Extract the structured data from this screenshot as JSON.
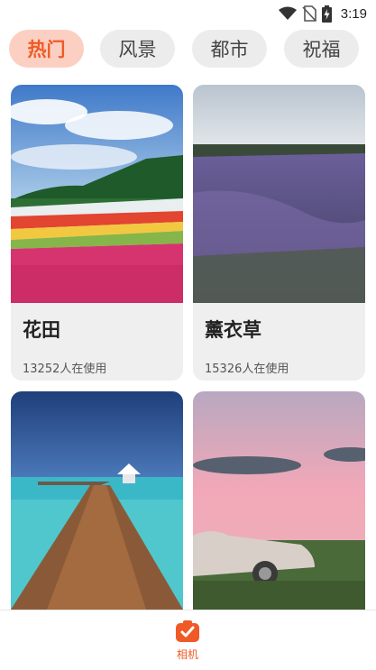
{
  "status_bar": {
    "time": "3:19",
    "icons": [
      "wifi-icon",
      "no-sim-icon",
      "battery-charging-icon"
    ]
  },
  "tabs": [
    {
      "label": "热门",
      "active": true
    },
    {
      "label": "风景",
      "active": false
    },
    {
      "label": "都市",
      "active": false
    },
    {
      "label": "祝福",
      "active": false
    }
  ],
  "cards": [
    {
      "title": "花田",
      "usage": "13252人在使用"
    },
    {
      "title": "薰衣草",
      "usage": "15326人在使用"
    },
    {
      "title": "",
      "usage": ""
    },
    {
      "title": "",
      "usage": ""
    }
  ],
  "bottom_nav": {
    "label": "相机",
    "icon": "camera-icon",
    "accent": "#ef5a26"
  }
}
